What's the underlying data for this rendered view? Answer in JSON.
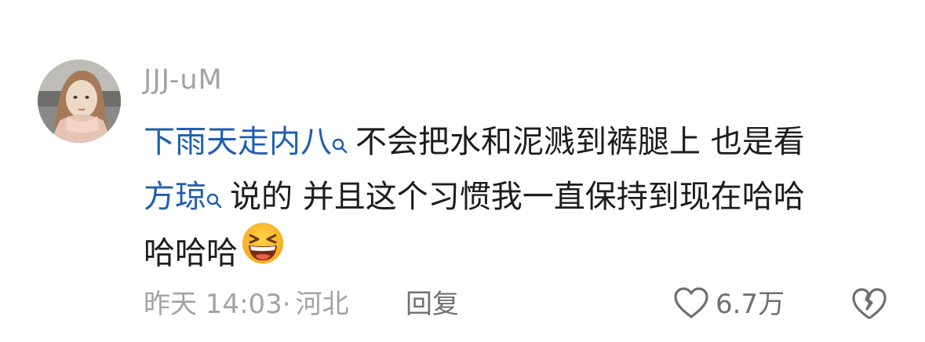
{
  "comment": {
    "username": "JJJ-uM",
    "avatar_icon": "user-avatar-photo",
    "text": {
      "line1_topic": "下雨天走内八",
      "line1_rest": "不会把水和泥溅到裤腿上 也是看",
      "line2_topic": "方琼",
      "line2_rest": "说的 并且这个习惯我一直保持到现在哈哈",
      "line3": "哈哈哈",
      "emoji": "laughing-squint-emoji"
    },
    "timestamp": "昨天 14:03",
    "separator": "·",
    "location": "河北",
    "reply_label": "回复",
    "likes": "6.7万",
    "like_icon": "heart-outline-icon",
    "dislike_icon": "broken-heart-icon"
  },
  "colors": {
    "topic_link": "#1f5fb0",
    "text": "#1c1c1c",
    "muted": "#a3a3a3",
    "action": "#707070"
  }
}
